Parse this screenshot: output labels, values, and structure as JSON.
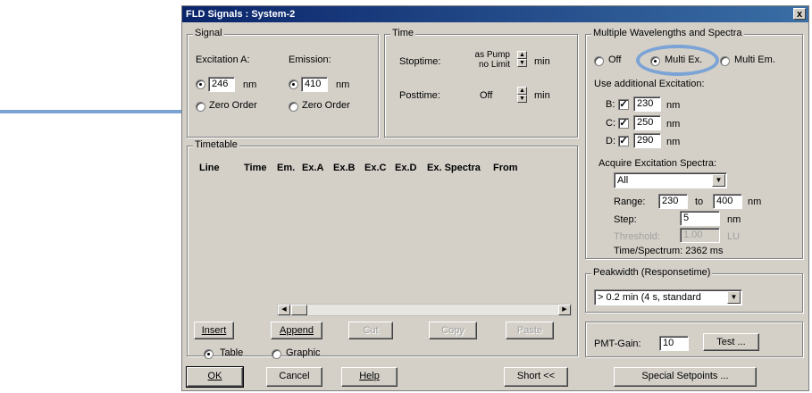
{
  "window": {
    "title": "FLD Signals : System-2",
    "close_glyph": "x"
  },
  "signal": {
    "legend": "Signal",
    "excitation_label": "Excitation A:",
    "emission_label": "Emission:",
    "excitation_value": "246",
    "emission_value": "410",
    "unit": "nm",
    "zero_order_label": "Zero Order"
  },
  "time": {
    "legend": "Time",
    "stoptime_label": "Stoptime:",
    "stoptime_value_line1": "as Pump",
    "stoptime_value_line2": "no Limit",
    "posttime_label": "Posttime:",
    "posttime_value": "Off",
    "unit": "min"
  },
  "timetable": {
    "legend": "Timetable",
    "columns": [
      "Line",
      "Time",
      "Em.",
      "Ex.A",
      "Ex.B",
      "Ex.C",
      "Ex.D",
      "Ex. Spectra",
      "From"
    ],
    "buttons": {
      "insert": "Insert",
      "append": "Append",
      "cut": "Cut",
      "copy": "Copy",
      "paste": "Paste"
    },
    "view_table": "Table",
    "view_graphic": "Graphic"
  },
  "multi": {
    "legend": "Multiple Wavelengths and Spectra",
    "off": "Off",
    "multi_ex": "Multi Ex.",
    "multi_em": "Multi Em.",
    "additional_label": "Use additional Excitation:",
    "b_label": "B:",
    "b_value": "230",
    "c_label": "C:",
    "c_value": "250",
    "d_label": "D:",
    "d_value": "290",
    "unit": "nm",
    "acquire_label": "Acquire Excitation Spectra:",
    "acquire_value": "All",
    "range_label": "Range:",
    "range_from": "230",
    "range_to_label": "to",
    "range_to": "400",
    "step_label": "Step:",
    "step_value": "5",
    "threshold_label": "Threshold:",
    "threshold_value": "1.00",
    "threshold_unit": "LU",
    "time_per_spectrum": "Time/Spectrum: 2362 ms"
  },
  "peakwidth": {
    "legend": "Peakwidth (Responsetime)",
    "value": "> 0.2 min  (4 s, standard"
  },
  "pmt": {
    "label": "PMT-Gain:",
    "value": "10",
    "test_button": "Test ..."
  },
  "footer": {
    "ok": "OK",
    "cancel": "Cancel",
    "help": "Help",
    "short": "Short <<",
    "special": "Special Setpoints ..."
  },
  "annotation": {
    "arrow_color": "#7ba3d6",
    "highlight_color": "#7ba3d6"
  },
  "icons": {
    "radio": "radio-button",
    "check": "checkbox-checked",
    "spin": "spin-arrows",
    "dropdown": "chevron-down-icon"
  }
}
